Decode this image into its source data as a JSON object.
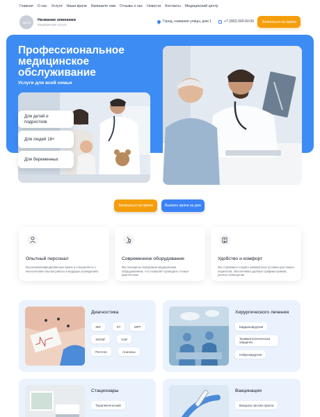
{
  "nav": {
    "items": [
      "Главная",
      "О нас",
      "Услуги",
      "Наши врачи",
      "Напишите нам",
      "Отзывы о нас",
      "Новости",
      "Контакты",
      "Медицинский центр"
    ]
  },
  "header": {
    "logo_text": "ЛОГО",
    "company_name": "Название компании",
    "company_sub": "Медицинские услуги",
    "address": "Город, название улицы, дом 1",
    "phone": "+7 (000) 000-00-00",
    "cta_label": "Записаться на прием"
  },
  "hero": {
    "title": "Профессиональное медицинское обслуживание",
    "subtitle": "Услуги для всей семьи",
    "pills": [
      "Для детей и подростков",
      "Для людей 18+",
      "Для беременных"
    ],
    "btn_book": "Записаться на прием",
    "btn_home": "Вызвать врача на дом"
  },
  "features": [
    {
      "icon": "doctor-icon",
      "title": "Опытный персонал",
      "desc": "Высококвалифицированные врачи и специалисты с многолетним опытом работы в ведущих учреждениях"
    },
    {
      "icon": "microscope-icon",
      "title": "Современное оборудование",
      "desc": "Мы оснащены передовым медицинским оборудованием, что позволяет проводить точные диагностики"
    },
    {
      "icon": "building-icon",
      "title": "Удобство и комфорт",
      "desc": "Мы стремимся создать комфортные условия для наших пациентов, обеспечивая удобные графики приема, уютные помещения"
    }
  ],
  "services": {
    "diagnostics": {
      "title": "Диагностика",
      "tags": [
        "ЭКГ",
        "КТ",
        "МРТ",
        "ЭХОКГ",
        "УЗИ",
        "Рентген",
        "Анализы"
      ]
    },
    "surgery": {
      "title": "Хирургического лечения",
      "tags": [
        "Кардиохирургия",
        "Травматологическая хирургия",
        "Нейрохирургия"
      ]
    },
    "hospital": {
      "title": "Стационары",
      "tags": [
        "Терапевтический"
      ]
    },
    "vaccination": {
      "title": "Вакцинация",
      "tags": [
        "Вакцина против гриппа"
      ]
    }
  },
  "colors": {
    "primary": "#3d8cf4",
    "accent": "#f59e0b",
    "card_bg": "#eaf2fd"
  }
}
